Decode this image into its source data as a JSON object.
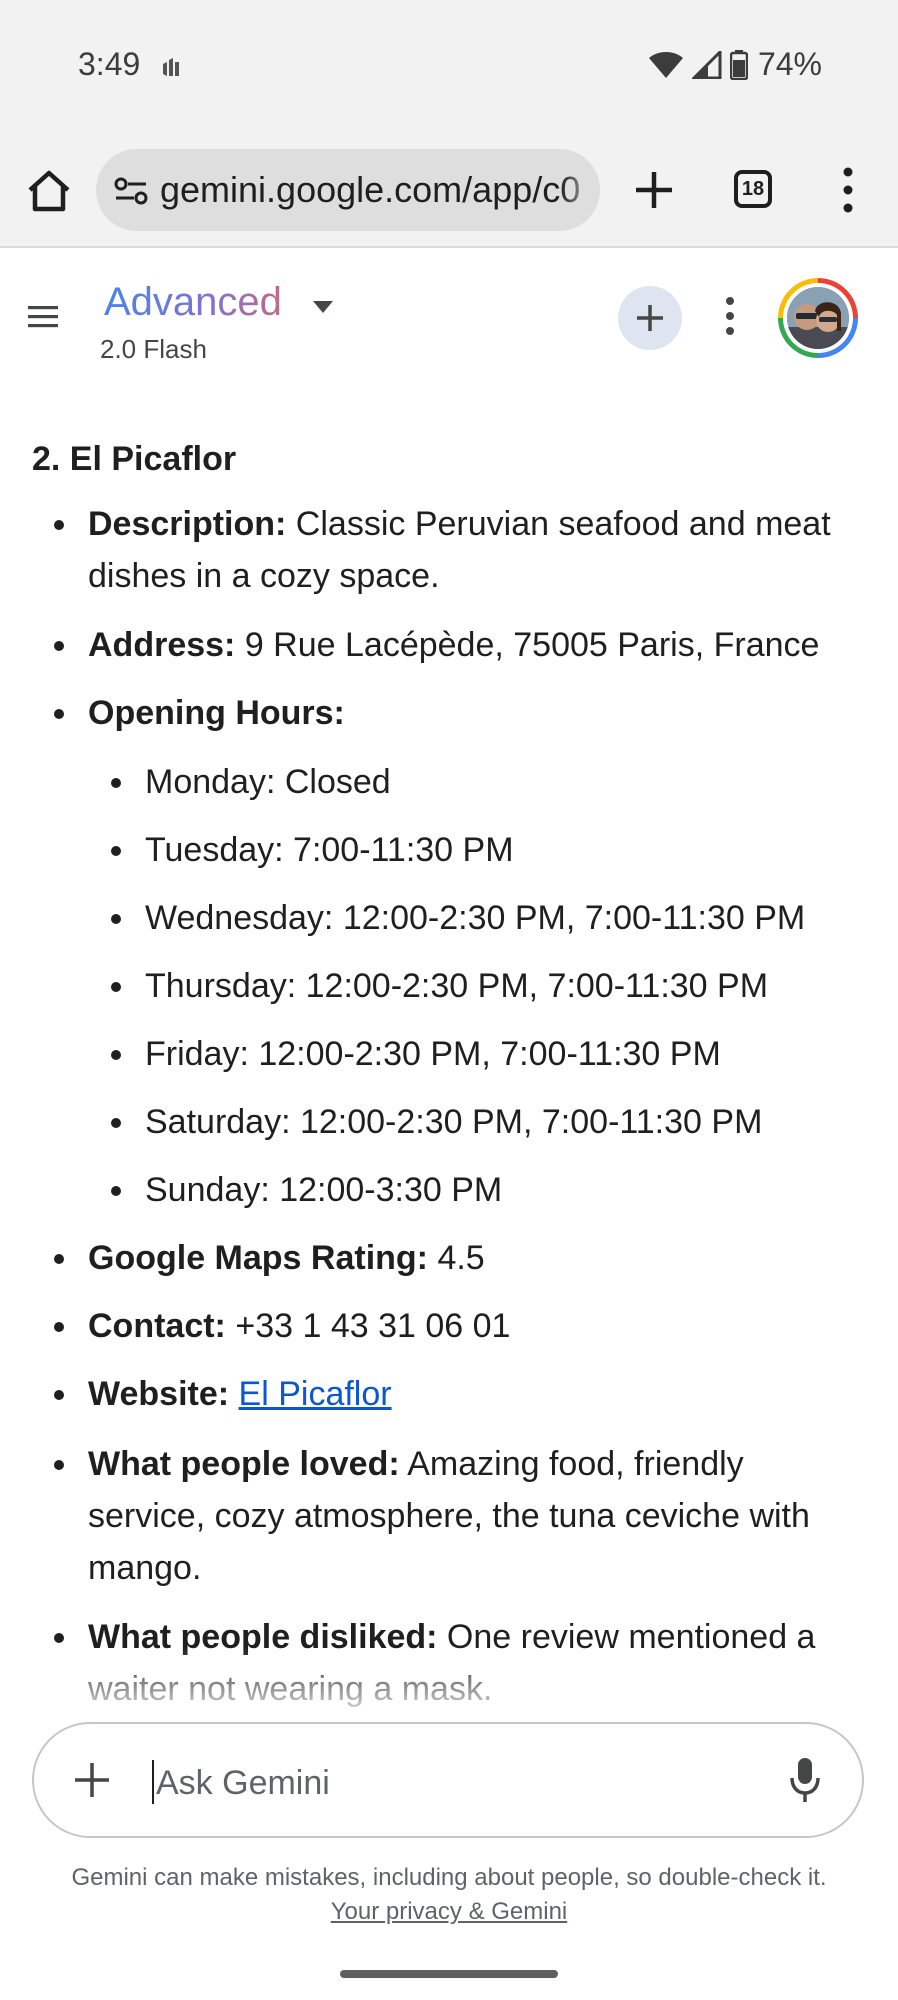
{
  "status_bar": {
    "time": "3:49",
    "battery": "74%"
  },
  "browser": {
    "url": "gemini.google.com/app/c0",
    "tab_count": "18"
  },
  "header": {
    "model_name": "Advanced",
    "model_version": "2.0 Flash"
  },
  "restaurant": {
    "heading": "2. El Picaflor",
    "description_label": "Description:",
    "description_value": " Classic Peruvian seafood and meat dishes in a cozy space.",
    "address_label": "Address:",
    "address_value": " 9 Rue Lacépède, 75005 Paris, France",
    "hours_label": "Opening Hours:",
    "hours": [
      "Monday: Closed",
      "Tuesday: 7:00-11:30 PM",
      "Wednesday: 12:00-2:30 PM, 7:00-11:30 PM",
      "Thursday: 12:00-2:30 PM, 7:00-11:30 PM",
      "Friday: 12:00-2:30 PM, 7:00-11:30 PM",
      "Saturday: 12:00-2:30 PM, 7:00-11:30 PM",
      "Sunday: 12:00-3:30 PM"
    ],
    "rating_label": "Google Maps Rating:",
    "rating_value": " 4.5",
    "contact_label": "Contact:",
    "contact_value": " +33 1 43 31 06 01",
    "website_label": "Website:",
    "website_link": "El Picaflor",
    "loved_label": "What people loved:",
    "loved_value": " Amazing food, friendly service, cozy atmosphere, the tuna ceviche with mango.",
    "disliked_label": "What people disliked:",
    "disliked_value": " One review mentioned a waiter not wearing a mask."
  },
  "input": {
    "placeholder": "Ask Gemini"
  },
  "footer": {
    "disclaimer": "Gemini can make mistakes, including about people, so double-check it.",
    "privacy_link": "Your privacy & Gemini"
  },
  "icons": {
    "home": "home-icon",
    "tune": "tune-icon",
    "plus": "plus-icon",
    "more": "more-vert-icon",
    "menu": "hamburger-icon",
    "caret": "dropdown-caret-icon",
    "mic": "microphone-icon"
  }
}
